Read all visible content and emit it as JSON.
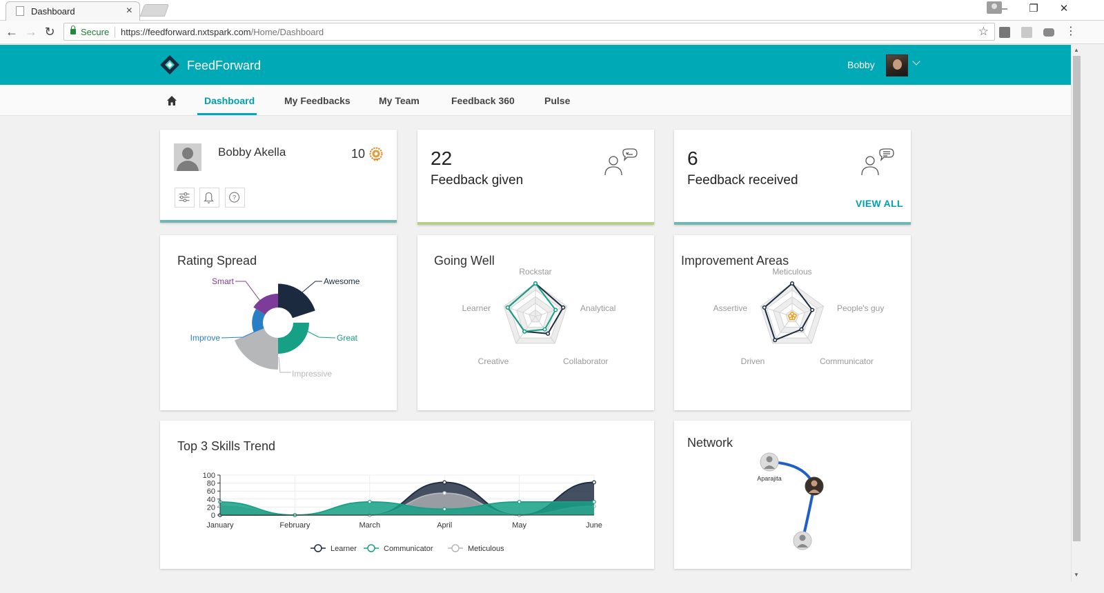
{
  "browser": {
    "tab_title": "Dashboard",
    "tab_close": "×",
    "secure_label": "Secure",
    "url_host": "https://feedforward.nxtspark.com",
    "url_path": "/Home/Dashboard",
    "window_controls": [
      "–",
      "❐",
      "✕"
    ]
  },
  "app": {
    "brand": "FeedForward",
    "user_name": "Bobby",
    "colors": {
      "header": "#00a9b6",
      "accent": "#00a0ad",
      "dark_series": "#1b2a3e",
      "teal_series": "#16a085",
      "grey_series": "#b5b7b9"
    }
  },
  "nav": {
    "items": [
      {
        "label": "Dashboard",
        "active": true
      },
      {
        "label": "My Feedbacks",
        "active": false
      },
      {
        "label": "My Team",
        "active": false
      },
      {
        "label": "Feedback 360",
        "active": false
      },
      {
        "label": "Pulse",
        "active": false
      }
    ]
  },
  "profile": {
    "name": "Bobby Akella",
    "points": "10",
    "actions": [
      "sliders-icon",
      "bell-icon",
      "help-icon"
    ]
  },
  "stats": {
    "given": {
      "count": "22",
      "label": "Feedback given"
    },
    "received": {
      "count": "6",
      "label": "Feedback received",
      "link": "VIEW ALL"
    }
  },
  "rating_spread": {
    "title": "Rating Spread",
    "chart_data": {
      "type": "pie",
      "variant": "rose-donut",
      "labels": [
        "Awesome",
        "Great",
        "Impressive",
        "Improve",
        "Smart"
      ],
      "values": [
        2.4,
        1.6,
        3.2,
        1.1,
        1.4
      ],
      "colors": [
        "#1b2a3e",
        "#16a085",
        "#b5b7b9",
        "#2a7fc4",
        "#7d3c98"
      ]
    }
  },
  "going_well": {
    "title": "Going Well",
    "chart_data": {
      "type": "radar",
      "axes": [
        "Rockstar",
        "Analytical",
        "Collaborator",
        "Creative",
        "Learner"
      ],
      "series": [
        {
          "values": [
            5,
            4.4,
            3.2,
            2.8,
            4.4
          ],
          "color": "#1b2a3e"
        },
        {
          "values": [
            5,
            3.2,
            2.4,
            2.8,
            4.4
          ],
          "color": "#16a085"
        }
      ],
      "max": 5
    }
  },
  "improvement_areas": {
    "title": "Improvement Areas",
    "chart_data": {
      "type": "radar",
      "axes": [
        "Meticulous",
        "People's guy",
        "Communicator",
        "Driven",
        "Assertive"
      ],
      "series": [
        {
          "values": [
            5,
            3.2,
            2.4,
            4.4,
            4.4
          ],
          "color": "#1b2a3e"
        },
        {
          "values": [
            0.4,
            0.4,
            0.3,
            0.3,
            0.3
          ],
          "color": "#f39c12"
        }
      ],
      "max": 5
    }
  },
  "skills_trend": {
    "title": "Top 3 Skills Trend",
    "chart_data": {
      "type": "area",
      "categories": [
        "January",
        "February",
        "March",
        "April",
        "May",
        "June"
      ],
      "ylim": [
        0,
        100
      ],
      "yticks": [
        0,
        20,
        40,
        60,
        80,
        100
      ],
      "series": [
        {
          "name": "Learner",
          "values": [
            0,
            0,
            0,
            82,
            0,
            82
          ],
          "color": "#1b2a3e"
        },
        {
          "name": "Communicator",
          "values": [
            33,
            0,
            33,
            15,
            33,
            33
          ],
          "color": "#16a085"
        },
        {
          "name": "Meticulous",
          "values": [
            22,
            0,
            0,
            55,
            0,
            22
          ],
          "color": "#b5b7b9"
        }
      ]
    }
  },
  "network": {
    "title": "Network",
    "nodes": [
      {
        "label": "Aparajita",
        "kind": "peer"
      },
      {
        "label": "",
        "kind": "self"
      },
      {
        "label": "",
        "kind": "peer"
      }
    ],
    "edge_color": "#1e5fc9"
  }
}
